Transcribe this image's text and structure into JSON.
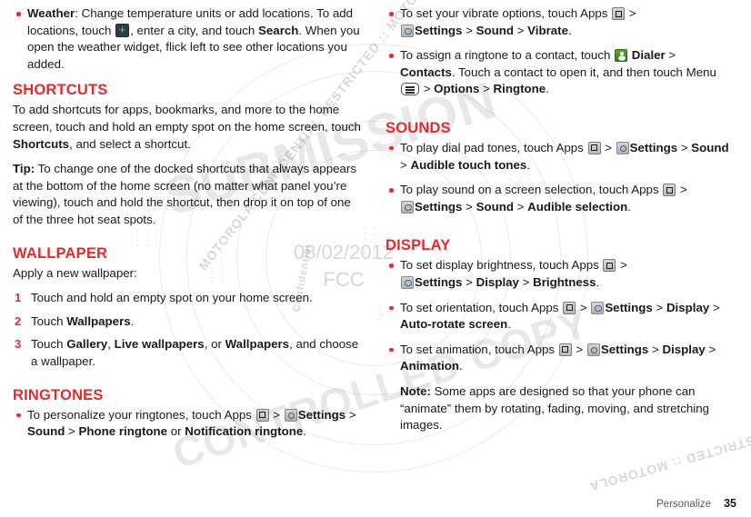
{
  "document": {
    "footer_section": "Personalize",
    "page_number": "35",
    "accent_color": "#e8292b"
  },
  "watermark": {
    "date": "08/02/2012",
    "agency": "FCC",
    "big_text": "SUBMISSION",
    "mid_text": "CONTROLLED COPY",
    "ring_text_top": "MOTOROLA CONFIDENTIAL RESTRICTED :: MOTOROLA",
    "ring_text_bottom": "MOTOROLA CONFIDENTIAL RESTRICTED :: MOTOROLA",
    "inner_text": "Confidential"
  },
  "left_column": {
    "weather_bullet": {
      "lead": "Weather",
      "text_1": ": Change temperature units or add locations. To add locations, touch ",
      "icon_1": "add-location-icon",
      "text_2": ", enter a city, and touch ",
      "bold_2": "Search",
      "text_3": ". When you open the weather widget, flick left to see other locations you added."
    },
    "shortcuts": {
      "heading": "SHORTCUTS",
      "para_1a": "To add shortcuts for apps, bookmarks, and more to the home screen, touch and hold an empty spot on the home screen, touch ",
      "para_1_bold": "Shortcuts",
      "para_1b": ", and select a shortcut.",
      "tip_label": "Tip:",
      "tip_text": " To change one of the docked shortcuts that always appears at the bottom of the home screen (no matter what panel you’re viewing), touch and hold the shortcut, then drop it on top of one of the three hot seat spots."
    },
    "wallpaper": {
      "heading": "WALLPAPER",
      "intro": "Apply a new wallpaper:",
      "step_1": "Touch and hold an empty spot on your home screen.",
      "step_2_pre": "Touch ",
      "step_2_bold": "Wallpapers",
      "step_2_post": ".",
      "step_3_pre": "Touch ",
      "step_3_bold_1": "Gallery",
      "step_3_mid_1": ", ",
      "step_3_bold_2": "Live wallpapers",
      "step_3_mid_2": ", or ",
      "step_3_bold_3": "Wallpapers",
      "step_3_post": ", and choose a wallpaper."
    },
    "ringtones": {
      "heading": "RINGTONES",
      "bullet_pre": "To personalize your ringtones, touch Apps ",
      "apps_icon": "apps-icon",
      "sep_1": " > ",
      "settings_icon": "settings-gear-icon",
      "bold_settings": "Settings",
      "sep_2": " > ",
      "bold_sound": "Sound",
      "sep_3": " > ",
      "bold_phone_ringtone": "Phone ringtone",
      "mid_or": " or ",
      "bold_notification_ringtone": "Notification ringtone",
      "end": "."
    }
  },
  "right_column": {
    "vibrate_bullet": {
      "pre": "To set your vibrate options, touch Apps ",
      "apps_icon": "apps-icon",
      "sep_1": " > ",
      "settings_icon": "settings-gear-icon",
      "bold_settings": "Settings",
      "sep_2": " > ",
      "bold_sound": "Sound",
      "sep_3": " > ",
      "bold_vibrate": "Vibrate",
      "end": "."
    },
    "contact_ringtone_bullet": {
      "pre": "To assign a ringtone to a contact, touch ",
      "dialer_icon": "dialer-contacts-icon",
      "bold_dialer": "Dialer",
      "sep_1": " > ",
      "bold_contacts": "Contacts",
      "mid": ". Touch a contact to open it, and then touch Menu ",
      "menu_icon": "menu-icon",
      "sep_2": " > ",
      "bold_options": "Options",
      "sep_3": " > ",
      "bold_ringtone": "Ringtone",
      "end": "."
    },
    "sounds": {
      "heading": "SOUNDS",
      "bullet_1": {
        "pre": "To play dial pad tones, touch Apps ",
        "apps_icon": "apps-icon",
        "sep_1": " > ",
        "settings_icon": "settings-gear-icon",
        "bold_settings": "Settings",
        "sep_2": " > ",
        "bold_sound": "Sound",
        "sep_3": " > ",
        "bold_target": "Audible touch tones",
        "end": "."
      },
      "bullet_2": {
        "pre": "To play sound on a screen selection, touch Apps ",
        "apps_icon": "apps-icon",
        "sep_1": " > ",
        "settings_icon": "settings-gear-icon",
        "bold_settings": "Settings",
        "sep_2": " > ",
        "bold_sound": "Sound",
        "sep_3": " > ",
        "bold_target": "Audible selection",
        "end": "."
      }
    },
    "display": {
      "heading": "DISPLAY",
      "bullet_1": {
        "pre": "To set display brightness, touch Apps ",
        "apps_icon": "apps-icon",
        "sep_1": " > ",
        "settings_icon": "settings-gear-icon",
        "bold_settings": "Settings",
        "sep_2": " > ",
        "bold_display": "Display",
        "sep_3": " > ",
        "bold_target": "Brightness",
        "end": "."
      },
      "bullet_2": {
        "pre": "To set orientation, touch Apps ",
        "apps_icon": "apps-icon",
        "sep_1": " > ",
        "settings_icon": "settings-gear-icon",
        "bold_settings": "Settings",
        "sep_2": " > ",
        "bold_display": "Display",
        "sep_3": " > ",
        "bold_target": "Auto-rotate screen",
        "end": "."
      },
      "bullet_3": {
        "pre": "To set animation, touch Apps ",
        "apps_icon": "apps-icon",
        "sep_1": " > ",
        "settings_icon": "settings-gear-icon",
        "bold_settings": "Settings",
        "sep_2": " > ",
        "bold_display": "Display",
        "sep_3": " > ",
        "bold_target": "Animation",
        "end": "."
      },
      "note_label": "Note:",
      "note_text": " Some apps are designed so that your phone can “animate” them by rotating, fading, moving, and stretching images."
    }
  }
}
